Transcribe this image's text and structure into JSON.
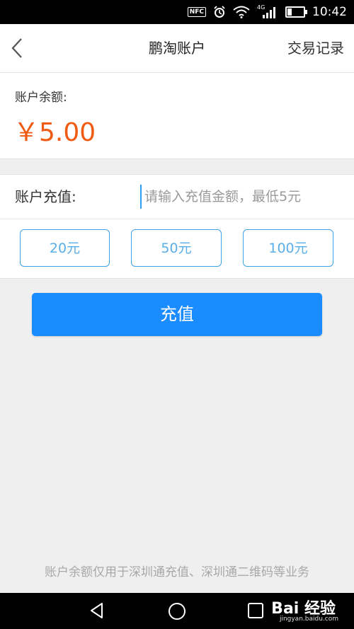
{
  "status_bar": {
    "nfc": "NFC",
    "network": "4G",
    "time": "10:42"
  },
  "header": {
    "title": "鹏淘账户",
    "records_label": "交易记录"
  },
  "balance": {
    "label": "账户余额:",
    "amount": "￥5.00"
  },
  "recharge": {
    "label": "账户充值:",
    "input_value": "",
    "input_placeholder": "请输入充值金额，最低5元",
    "presets": [
      "20元",
      "50元",
      "100元"
    ]
  },
  "submit_label": "充值",
  "footer_note": "账户余额仅用于深圳通充值、深圳通二维码等业务",
  "watermark": {
    "brand": "Bai 经验",
    "url": "jingyan.baidu.com"
  },
  "colors": {
    "accent": "#1a8cff",
    "amount": "#f05a12",
    "preset_border": "#3ea3e6"
  }
}
